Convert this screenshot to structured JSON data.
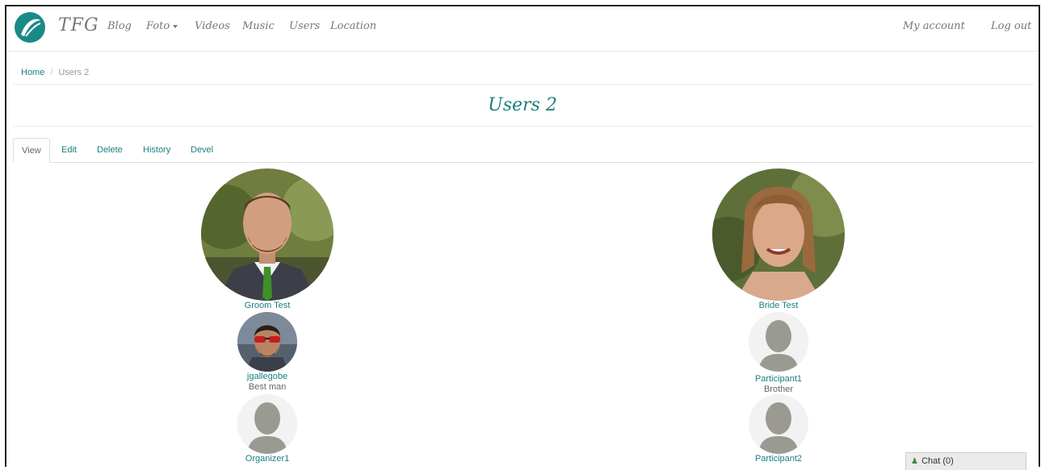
{
  "nav": {
    "brand": "TFG",
    "items": [
      "Blog",
      "Foto",
      "Videos",
      "Music",
      "Users",
      "Location"
    ],
    "right": [
      "My account",
      "Log out"
    ]
  },
  "breadcrumb": {
    "home": "Home",
    "separator": "/",
    "current": "Users 2"
  },
  "page_title": "Users 2",
  "tabs": [
    "View",
    "Edit",
    "Delete",
    "History",
    "Devel"
  ],
  "people": {
    "groom": {
      "name": "Groom Test"
    },
    "bride": {
      "name": "Bride Test"
    },
    "best_man": {
      "name": "jgallegobe",
      "role": "Best man"
    },
    "participant1": {
      "name": "Participant1",
      "role": "Brother"
    },
    "organizer1": {
      "name": "Organizer1"
    },
    "participant2": {
      "name": "Participant2"
    }
  },
  "chat": {
    "label": "Chat (0)"
  },
  "colors": {
    "accent": "#1a7f7f",
    "logo": "#1a8a87",
    "nav_text": "#777777"
  }
}
